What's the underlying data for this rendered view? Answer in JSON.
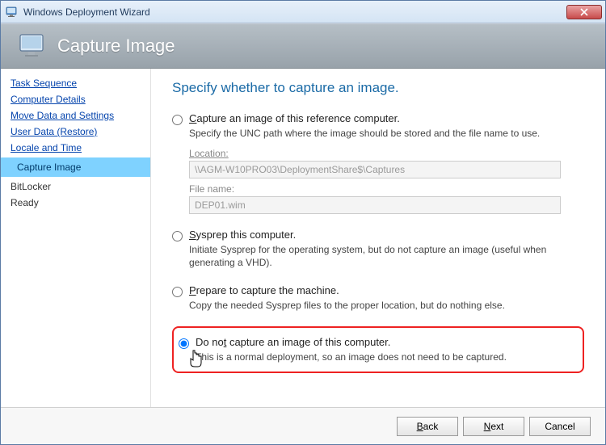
{
  "window": {
    "title": "Windows Deployment Wizard"
  },
  "header": {
    "title": "Capture Image"
  },
  "sidebar": {
    "items": [
      {
        "label": "Task Sequence",
        "type": "link"
      },
      {
        "label": "Computer Details",
        "type": "link"
      },
      {
        "label": "Move Data and Settings",
        "type": "link"
      },
      {
        "label": "User Data (Restore)",
        "type": "link"
      },
      {
        "label": "Locale and Time",
        "type": "link"
      },
      {
        "label": "Capture Image",
        "type": "active"
      },
      {
        "label": "BitLocker",
        "type": "plain"
      },
      {
        "label": "Ready",
        "type": "plain"
      }
    ]
  },
  "main": {
    "heading": "Specify whether to capture an image.",
    "options": {
      "capture": {
        "label_pre": "C",
        "label_post": "apture an image of this reference computer.",
        "desc": "Specify the UNC path where the image should be stored and the file name to use.",
        "location_label_pre": "L",
        "location_label_post": "ocation:",
        "location_value": "\\\\AGM-W10PRO03\\DeploymentShare$\\Captures",
        "filename_label": "File name:",
        "filename_value": "DEP01.wim"
      },
      "sysprep": {
        "label_pre": "S",
        "label_post": "ysprep this computer.",
        "desc": "Initiate Sysprep for the operating system, but do not capture an image (useful when generating a VHD)."
      },
      "prepare": {
        "label_pre": "P",
        "label_post": "repare to capture the machine.",
        "desc": "Copy the needed Sysprep files to the proper location, but do nothing else."
      },
      "donot": {
        "label_pre": "Do no",
        "label_ak": "t",
        "label_post": " capture an image of this computer.",
        "desc": "This is a normal deployment, so an image does not need to be captured."
      }
    }
  },
  "footer": {
    "back_pre": "B",
    "back_post": "ack",
    "next_pre": "N",
    "next_post": "ext",
    "cancel": "Cancel"
  }
}
